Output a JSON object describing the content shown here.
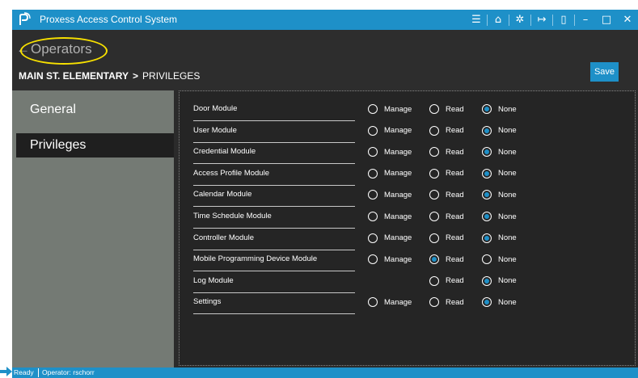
{
  "app": {
    "title": "Proxess Access Control System"
  },
  "titlebar_icons": [
    "menu-icon",
    "home-icon",
    "settings-icon",
    "logout-icon",
    "card-icon",
    "minimize-icon",
    "maximize-icon",
    "close-icon"
  ],
  "header": {
    "back_label": "Operators",
    "breadcrumb_root": "MAIN ST. ELEMENTARY",
    "breadcrumb_sep": ">",
    "breadcrumb_current": "PRIVILEGES",
    "save_label": "Save"
  },
  "sidebar": {
    "items": [
      {
        "label": "General"
      },
      {
        "label": "Privileges"
      }
    ]
  },
  "privileges": {
    "labels": {
      "manage": "Manage",
      "read": "Read",
      "none": "None"
    },
    "rows": [
      {
        "module": "Door Module",
        "selected": "none"
      },
      {
        "module": "User Module",
        "selected": "none"
      },
      {
        "module": "Credential Module",
        "selected": "none"
      },
      {
        "module": "Access Profile Module",
        "selected": "none"
      },
      {
        "module": "Calendar Module",
        "selected": "none"
      },
      {
        "module": "Time Schedule Module",
        "selected": "none"
      },
      {
        "module": "Controller Module",
        "selected": "none"
      },
      {
        "module": "Mobile Programming Device Module",
        "selected": "read"
      },
      {
        "module": "Log Module",
        "selected": "none",
        "no_manage": true
      },
      {
        "module": "Settings",
        "selected": "none"
      }
    ]
  },
  "status": {
    "ready": "Ready",
    "operator": "Operator: rschorr"
  },
  "colors": {
    "accent": "#1e90c8",
    "highlight": "#f7e000",
    "sidebar": "#747a74",
    "background": "#2b2b2b"
  }
}
